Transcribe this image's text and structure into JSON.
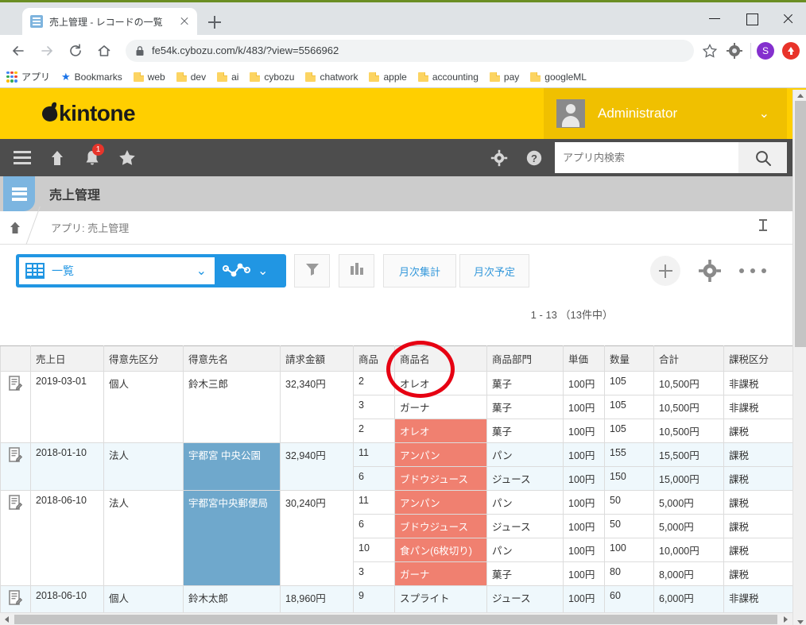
{
  "browser": {
    "tab_title": "売上管理 - レコードの一覧",
    "tab_favicon": "app-favicon",
    "new_tab_label": "+",
    "url": "fe54k.cybozu.com/k/483/?view=5566962",
    "lock_icon": "lock-icon",
    "star_icon": "bookmark-star-icon",
    "extension_icon": "extension-gear-icon",
    "profile_initial": "S",
    "window_controls": {
      "minimize": "—",
      "maximize": "▢",
      "close": "✕"
    },
    "bookmarks": [
      {
        "label": "アプリ",
        "icon": "apps-grid-icon"
      },
      {
        "label": "Bookmarks",
        "icon": "star-icon"
      },
      {
        "label": "web",
        "icon": "folder-icon"
      },
      {
        "label": "dev",
        "icon": "folder-icon"
      },
      {
        "label": "ai",
        "icon": "folder-icon"
      },
      {
        "label": "cybozu",
        "icon": "folder-icon"
      },
      {
        "label": "chatwork",
        "icon": "folder-icon"
      },
      {
        "label": "apple",
        "icon": "folder-icon"
      },
      {
        "label": "accounting",
        "icon": "folder-icon"
      },
      {
        "label": "pay",
        "icon": "folder-icon"
      },
      {
        "label": "googleML",
        "icon": "folder-icon"
      }
    ]
  },
  "kintone": {
    "brand": "kintone",
    "brand_bg": "#ffcf00",
    "user_name": "Administrator",
    "user_caret": "⌄",
    "nav_icons": [
      {
        "name": "menu-icon"
      },
      {
        "name": "home-icon"
      },
      {
        "name": "bell-icon",
        "badge": "1"
      },
      {
        "name": "star-icon"
      }
    ],
    "nav_right_icons": [
      {
        "name": "gear-icon"
      },
      {
        "name": "help-icon"
      }
    ],
    "search_placeholder": "アプリ内検索",
    "search_value": "",
    "search_button_icon": "search-icon"
  },
  "app": {
    "icon": "app-list-icon",
    "title": "売上管理",
    "breadcrumb_home_icon": "home-icon",
    "breadcrumb": "アプリ: 売上管理",
    "pin_icon": "pin-icon"
  },
  "toolbar": {
    "view_icon": "table-view-icon",
    "view_label": "一覧",
    "view_caret": "⌄",
    "graph_icon": "graph-icon",
    "graph_caret": "⌄",
    "filter_icon": "funnel-filter-icon",
    "chart_icon": "bar-chart-icon",
    "button_monthly_total": "月次集計",
    "button_monthly_plan": "月次予定",
    "add_icon": "plus-icon",
    "settings_icon": "gear-icon",
    "more_icon": "more-dots-icon",
    "annotation_color": "#e60012"
  },
  "record_count": "1 - 13 （13件中）",
  "table": {
    "columns": [
      "売上日",
      "得意先区分",
      "得意先名",
      "請求金額",
      "商品",
      "商品名",
      "商品部門",
      "単価",
      "数量",
      "合計",
      "課税区分"
    ],
    "records": [
      {
        "edit_icon": "record-edit-icon",
        "hover": false,
        "date": "2019-03-01",
        "customer_type": "個人",
        "customer_name": "鈴木三郎",
        "customer_name_highlight": "none",
        "invoice_amount": "32,340円",
        "lines": [
          {
            "product_no": "2",
            "product_name": "オレオ",
            "product_name_highlight": "red-none",
            "dept": "菓子",
            "unit_price": "100円",
            "qty": "105",
            "total": "10,500円",
            "tax": "非課税"
          },
          {
            "product_no": "3",
            "product_name": "ガーナ",
            "product_name_highlight": "none",
            "dept": "菓子",
            "unit_price": "100円",
            "qty": "105",
            "total": "10,500円",
            "tax": "非課税"
          },
          {
            "product_no": "2",
            "product_name": "オレオ",
            "product_name_highlight": "red",
            "dept": "菓子",
            "unit_price": "100円",
            "qty": "105",
            "total": "10,500円",
            "tax": "課税"
          }
        ]
      },
      {
        "edit_icon": "record-edit-icon",
        "hover": true,
        "date": "2018-01-10",
        "customer_type": "法人",
        "customer_name": "宇都宮 中央公園",
        "customer_name_highlight": "blue",
        "invoice_amount": "32,940円",
        "lines": [
          {
            "product_no": "11",
            "product_name": "アンパン",
            "product_name_highlight": "red",
            "dept": "パン",
            "unit_price": "100円",
            "qty": "155",
            "total": "15,500円",
            "tax": "課税"
          },
          {
            "product_no": "6",
            "product_name": "ブドウジュース",
            "product_name_highlight": "red",
            "dept": "ジュース",
            "unit_price": "100円",
            "qty": "150",
            "total": "15,000円",
            "tax": "課税"
          }
        ]
      },
      {
        "edit_icon": "record-edit-icon",
        "hover": false,
        "date": "2018-06-10",
        "customer_type": "法人",
        "customer_name": "宇都宮中央郵便局",
        "customer_name_highlight": "blue",
        "invoice_amount": "30,240円",
        "lines": [
          {
            "product_no": "11",
            "product_name": "アンパン",
            "product_name_highlight": "red",
            "dept": "パン",
            "unit_price": "100円",
            "qty": "50",
            "total": "5,000円",
            "tax": "課税"
          },
          {
            "product_no": "6",
            "product_name": "ブドウジュース",
            "product_name_highlight": "red",
            "dept": "ジュース",
            "unit_price": "100円",
            "qty": "50",
            "total": "5,000円",
            "tax": "課税"
          },
          {
            "product_no": "10",
            "product_name": "食パン(6枚切り)",
            "product_name_highlight": "red",
            "dept": "パン",
            "unit_price": "100円",
            "qty": "100",
            "total": "10,000円",
            "tax": "課税"
          },
          {
            "product_no": "3",
            "product_name": "ガーナ",
            "product_name_highlight": "red",
            "dept": "菓子",
            "unit_price": "100円",
            "qty": "80",
            "total": "8,000円",
            "tax": "課税"
          }
        ]
      },
      {
        "edit_icon": "record-edit-icon",
        "hover": true,
        "date": "2018-06-10",
        "customer_type": "個人",
        "customer_name": "鈴木太郎",
        "customer_name_highlight": "none",
        "invoice_amount": "18,960円",
        "lines": [
          {
            "product_no": "9",
            "product_name": "スプライト",
            "product_name_highlight": "none",
            "dept": "ジュース",
            "unit_price": "100円",
            "qty": "60",
            "total": "6,000円",
            "tax": "非課税"
          }
        ]
      }
    ]
  },
  "colors": {
    "brand_yellow": "#ffcf00",
    "accent_blue": "#2196e3",
    "highlight_red": "#f08070",
    "highlight_blue": "#6fa8cc",
    "annotation_red": "#e60012"
  }
}
